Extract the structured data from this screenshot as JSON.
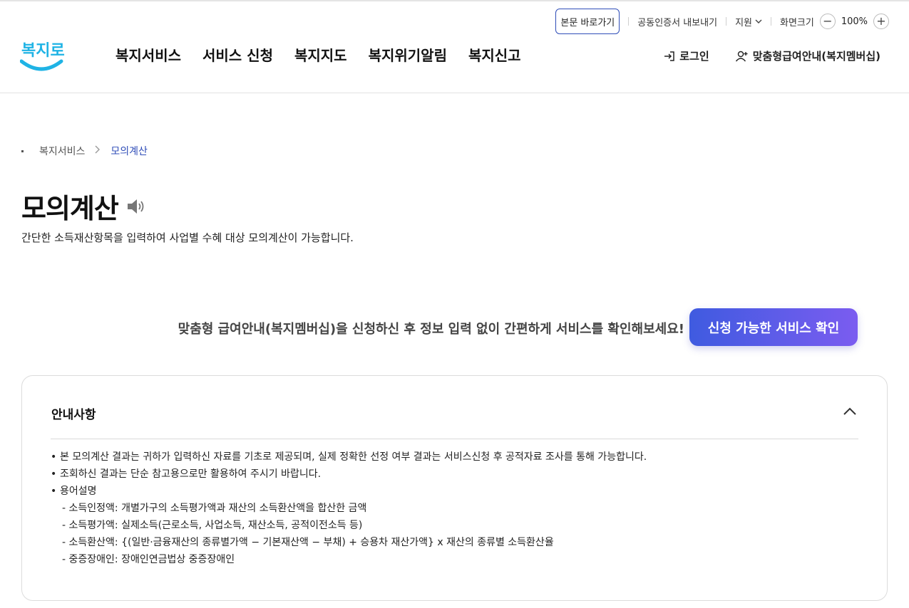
{
  "utility": {
    "skip_label": "본문 바로가기",
    "cert_label": "공동인증서 내보내기",
    "support_label": "지원",
    "zoom_label": "화면크기",
    "zoom_value": "100%",
    "zoom_out": "−",
    "zoom_in": "+"
  },
  "logo": {
    "text": "복지로"
  },
  "nav": {
    "items": [
      {
        "label": "복지서비스"
      },
      {
        "label": "서비스 신청"
      },
      {
        "label": "복지지도"
      },
      {
        "label": "복지위기알림"
      },
      {
        "label": "복지신고"
      }
    ]
  },
  "header_right": {
    "login_label": "로그인",
    "membership_label": "맞춤형급여안내(복지멤버십)"
  },
  "breadcrumb": {
    "items": [
      "복지서비스",
      "모의계산"
    ],
    "separator": ">"
  },
  "page": {
    "title": "모의계산",
    "description": "간단한 소득재산항목을 입력하여 사업별 수혜 대상 모의계산이 가능합니다."
  },
  "cta": {
    "text": "맞춤형 급여안내(복지멤버십)을 신청하신 후 정보 입력 없이 간편하게 서비스를 확인해보세요!",
    "button_label": "신청 가능한 서비스 확인"
  },
  "info": {
    "heading": "안내사항",
    "bullets": [
      "본 모의계산 결과는 귀하가 입력하신 자료를 기초로 제공되며, 실제 정확한 선정 여부 결과는 서비스신청 후 공적자료 조사를 통해 가능합니다.",
      "조회하신 결과는 단순 참고용으로만 활용하여 주시기 바랍니다.",
      "용어설명"
    ],
    "terms": [
      "- 소득인정액: 개별가구의 소득평가액과 재산의 소득환산액을 합산한 금액",
      "- 소득평가액: 실제소득(근로소득, 사업소득, 재산소득, 공적이전소득 등)",
      "- 소득환산액: {(일반·금융재산의 종류별가액 − 기본재산액 − 부채) + 승용차 재산가액} x 재산의 종류별 소득환산율",
      "- 중증장애인: 장애인연금법상 중증장애인"
    ]
  },
  "colors": {
    "accent": "#2f4db8",
    "cta_start": "#3f5be0",
    "cta_end": "#7b5cf0",
    "logo": "#1fb3e5"
  }
}
